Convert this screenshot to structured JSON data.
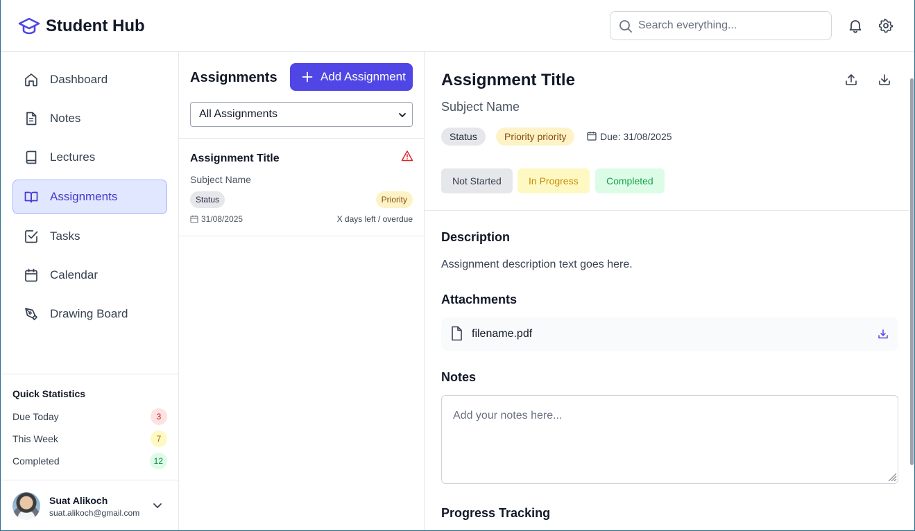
{
  "app": {
    "title": "Student Hub",
    "brand_color": "#4f46e5"
  },
  "header": {
    "search_placeholder": "Search everything...",
    "icons": [
      "search-icon",
      "bell-icon",
      "gear-icon"
    ]
  },
  "sidebar": {
    "items": [
      {
        "label": "Dashboard",
        "icon": "home-icon",
        "active": false
      },
      {
        "label": "Notes",
        "icon": "file-text-icon",
        "active": false
      },
      {
        "label": "Lectures",
        "icon": "book-icon",
        "active": false
      },
      {
        "label": "Assignments",
        "icon": "book-open-icon",
        "active": true
      },
      {
        "label": "Tasks",
        "icon": "check-square-icon",
        "active": false
      },
      {
        "label": "Calendar",
        "icon": "calendar-icon",
        "active": false
      },
      {
        "label": "Drawing Board",
        "icon": "pen-tool-icon",
        "active": false
      }
    ],
    "stats": {
      "title": "Quick Statistics",
      "rows": [
        {
          "label": "Due Today",
          "count": "3",
          "bg": "#fee2e2",
          "fg": "#b91c1c"
        },
        {
          "label": "This Week",
          "count": "7",
          "bg": "#fef9c3",
          "fg": "#a16207"
        },
        {
          "label": "Completed",
          "count": "12",
          "bg": "#dcfce7",
          "fg": "#15803d"
        }
      ]
    },
    "user": {
      "name": "Suat Alikoch",
      "email": "suat.alikoch@gmail.com"
    }
  },
  "list": {
    "title": "Assignments",
    "add_label": "Add Assignment",
    "filter_selected": "All Assignments",
    "card": {
      "title": "Assignment Title",
      "subject": "Subject Name",
      "status": "Status",
      "priority": "Priority",
      "date": "31/08/2025",
      "days": "X days left / overdue"
    }
  },
  "detail": {
    "title": "Assignment Title",
    "subject": "Subject Name",
    "status": "Status",
    "priority": "Priority priority",
    "due": "Due: 31/08/2025",
    "status_buttons": [
      {
        "label": "Not Started",
        "bg": "#e5e7eb",
        "fg": "#374151"
      },
      {
        "label": "In Progress",
        "bg": "#fef9c3",
        "fg": "#ca8a04"
      },
      {
        "label": "Completed",
        "bg": "#dcfce7",
        "fg": "#16a34a"
      }
    ],
    "description_title": "Description",
    "description": "Assignment description text goes here.",
    "attachments_title": "Attachments",
    "attachment_name": "filename.pdf",
    "notes_title": "Notes",
    "notes_placeholder": "Add your notes here...",
    "progress_title": "Progress Tracking"
  }
}
